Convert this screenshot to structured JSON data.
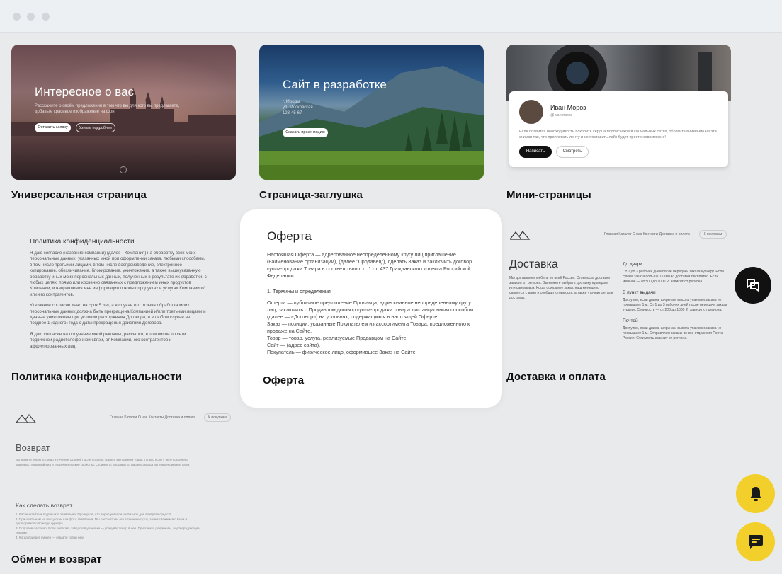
{
  "cards": [
    {
      "title": "Универсальная страница",
      "hero_title": "Интересное о вас",
      "hero_text": "Расскажите о своём предложении в том что вы для кого вы предлагаете, добавьте красивое изображение на фон",
      "btn_primary": "Оставить заявку",
      "btn_secondary": "Узнать подробнее"
    },
    {
      "title": "Страница-заглушка",
      "hero_title": "Сайт в разработке",
      "hero_lines": [
        "г. Москва",
        "ул. Московская",
        "123-45-67"
      ],
      "btn_primary": "Скачать презентацию"
    },
    {
      "title": "Мини-страницы",
      "profile_name": "Иван Мороз",
      "profile_handle": "@ivanmoroz",
      "profile_text": "Если появится необходимость покорить сердца подписчиков в социальных сетях, обратите внимание на эти снимки так, что пролистать ленту и не поставить лайк будет просто невозможно!",
      "btn_primary": "Написать",
      "btn_secondary": "Смотреть"
    },
    {
      "title": "Политика конфиденциальности",
      "doc_title": "Политика конфиденциальности",
      "paragraphs": [
        "Я даю согласие (название компании) (далее - Компания) на обработку всех моих персональных данных, указанных мной при оформлении заказа, любыми способами, в том числе третьими лицами, в том числе воспроизведение, электронное копирование, обезличивание, блокирование, уничтожение, а также вышеуказанную обработку иных моих персональных данных, полученных в результате их обработки, с любых целях, прямо или косвенно связанных с предложением иных продуктов Компании, и направления мне информации о новых продуктах и услугах Компании и/или его контрагентов.",
        "Указанное согласие дано на срок 5 лет, а в случае его отзыва обработка моих персональных данных должна быть прекращена Компанией и/или третьими лицами и данные уничтожены при условии расторжения Договора, и в любом случае не позднее 1 (одного) года с даты прекращения действия Договора.",
        "Я даю согласие на получение мной рекламы, рассылки, в том числе по сети подвижной радиотелефонной связи, от Компании, его контрагентов и аффилированных лиц."
      ]
    },
    {
      "title": "Оферта",
      "doc_title": "Оферта",
      "intro": "Настоящая Оферта — адресованное неопределенному кругу лиц приглашение (наименование организации), (далее \"Продавец\"), сделать Заказ и заключить договор купли-продажи Товара в соответствии с п. 1 ст. 437 Гражданского кодекса Российской Федерации.",
      "section": "1. Термины и определения",
      "terms": [
        "Оферта — публичное предложение Продавца, адресованное неопределенному кругу лиц, заключить с Продавцом договор купли-продажи товара дистанционным способом (далее — «Договор») на условиях, содержащихся в настоящей Оферте.",
        "Заказ — позиции, указанные Покупателем из ассортимента Товара, предложенного к продаже на Сайте.",
        "Товар — товар, услуга, реализуемые Продавцом на Сайте.",
        "Сайт — (адрес сайта).",
        "Покупатель — физическое лицо, оформившее Заказ на Сайте."
      ]
    },
    {
      "title": "Доставка и оплата",
      "nav": "Главная   Каталог   О нас   Контакты   Доставка и оплата",
      "cart": "К покупкам",
      "page_title": "Доставка",
      "lead": "Мы доставляем мебель по всей России. Стоимость доставки зависит от региона. Вы можете выбрать доставку курьером или самовывоз. Когда оформите заказ, наш менеджер свяжется с вами и сообщит стоимость, а также уточнит детали доставки.",
      "blocks": [
        {
          "h": "До двери",
          "t": "От 1 до 3 рабочих дней после передачи заказа курьеру. Если сумма заказа больше 15 000 ₽, доставка бесплатно. Если меньше — от 500 до 1000 ₽, зависит от региона."
        },
        {
          "h": "В пункт выдачи",
          "t": "Доступно, если длина, ширина и высота упаковки заказа не превышает 1 м. От 1 до 3 рабочих дней после передачи заказа курьеру. Стоимость — от 200 до 1000 ₽, зависит от региона."
        },
        {
          "h": "Почтой",
          "t": "Доступно, если длина, ширина и высота упаковки заказа не превышает 1 м. Отправляем заказы во все отделения Почты России. Стоимость зависит от региона."
        }
      ]
    },
    {
      "title": "Обмен и возврат",
      "nav": "Главная   Каталог   О нас   Контакты   Доставка и оплата",
      "cart": "К покупкам",
      "page_title": "Возврат",
      "lead": "Вы можете вернуть товар в течение 14 дней после покупки. Важно: мы примем товар, только если у него сохранена упаковка, товарный вид и потребительские свойства. Стоимость доставки до нашего склада вы компенсируете сами.",
      "sub_title": "Как сделать возврат",
      "steps": [
        "1. Распечатайте и подпишите заявление. Проверьте, что верно указали реквизиты для возврата средств.",
        "2. Пришлите нам на почту скан или фото заявления. Мы рассмотрим его в течение суток, затем свяжемся с вами и договоримся о приезде курьера.",
        "3. Подготовьте товар. Если оплатить заводская упаковка — упакуйте товар в неё. Приложите документы, подтверждающие покупку.",
        "4. Когда приедет курьер — отдайте товар ему."
      ]
    }
  ],
  "colors": {
    "accent_yellow": "#f2cf2a",
    "dark": "#111111",
    "background": "#e9eaec"
  },
  "fabs": [
    "chat-bubbles-icon",
    "bell-icon",
    "message-icon"
  ]
}
